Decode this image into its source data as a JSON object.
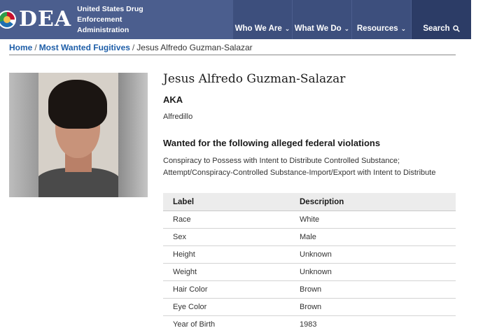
{
  "header": {
    "logo_text": "DEA",
    "agency_line1": "United States Drug Enforcement",
    "agency_line2": "Administration",
    "nav": [
      {
        "label": "Who We Are"
      },
      {
        "label": "What We Do"
      },
      {
        "label": "Resources"
      },
      {
        "label": "Search"
      }
    ],
    "colors": {
      "header_bg": "#4b5e8e",
      "nav_bg": "#3d4f7d",
      "search_bg": "#2c3c66",
      "link": "#1e5ea8"
    }
  },
  "breadcrumb": {
    "home": "Home",
    "parent": "Most Wanted Fugitives",
    "current": "Jesus Alfredo Guzman-Salazar"
  },
  "profile": {
    "name": "Jesus Alfredo Guzman-Salazar",
    "aka_title": "AKA",
    "aka_value": "Alfredillo",
    "violations_title": "Wanted for the following alleged federal violations",
    "violations_line1": "Conspiracy to Possess with Intent to Distribute Controlled Substance;",
    "violations_line2": "Attempt/Conspiracy-Controlled Substance-Import/Export with Intent to Distribute"
  },
  "details_table": {
    "headers": {
      "label": "Label",
      "description": "Description"
    },
    "rows": [
      {
        "label": "Race",
        "value": "White"
      },
      {
        "label": "Sex",
        "value": "Male"
      },
      {
        "label": "Height",
        "value": "Unknown"
      },
      {
        "label": "Weight",
        "value": "Unknown"
      },
      {
        "label": "Hair Color",
        "value": "Brown"
      },
      {
        "label": "Eye Color",
        "value": "Brown"
      },
      {
        "label": "Year of Birth",
        "value": "1983"
      }
    ]
  },
  "icons": {
    "seal": "dea-seal-icon",
    "chevron": "chevron-down-icon",
    "search": "search-icon"
  }
}
